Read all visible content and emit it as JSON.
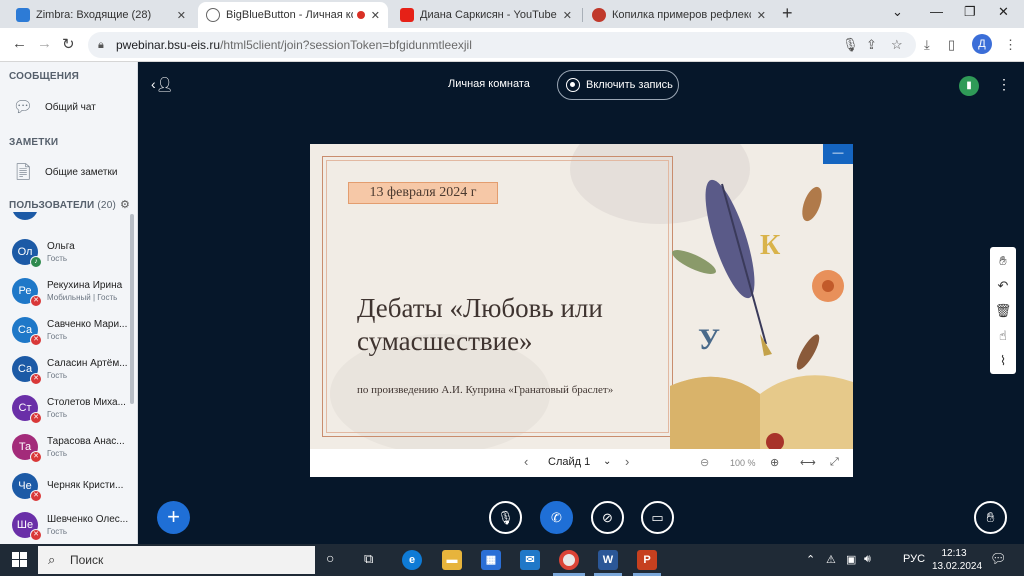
{
  "browser": {
    "tabs": [
      {
        "title": "Zimbra: Входящие (28)",
        "icon": "zimbra-icon",
        "color": "#2d7bd6"
      },
      {
        "title": "BigBlueButton - Личная ком",
        "icon": "globe-icon",
        "color": "#555555",
        "active": true
      },
      {
        "title": "Диана Саркисян - YouTube",
        "icon": "youtube-icon",
        "color": "#e62117"
      },
      {
        "title": "Копилка примеров рефлекси",
        "icon": "star-icon",
        "color": "#c0392b"
      }
    ],
    "url_host": "pwebinar.bsu-eis.ru",
    "url_path": "/html5client/join?sessionToken=bfgidunmtleexjil",
    "profile_initial": "Д"
  },
  "sidebar": {
    "messages_title": "СООБЩЕНИЯ",
    "public_chat": "Общий чат",
    "notes_title": "ЗАМЕТКИ",
    "shared_notes": "Общие заметки",
    "users_title": "ПОЛЬЗОВАТЕЛИ",
    "users_count": "(20)",
    "users": [
      {
        "initials": "Ол",
        "name": "Ольга",
        "role": "Гость",
        "color": "#1c5aa6",
        "status": "ok"
      },
      {
        "initials": "Ре",
        "name": "Рекухина Ирина",
        "role": "Мобильный | Гость",
        "color": "#1f78c8",
        "status": "muted"
      },
      {
        "initials": "Са",
        "name": "Савченко Мари...",
        "role": "Гость",
        "color": "#1f78c8",
        "status": "muted"
      },
      {
        "initials": "Са",
        "name": "Саласин Артём...",
        "role": "Гость",
        "color": "#1c5aa6",
        "status": "muted"
      },
      {
        "initials": "Ст",
        "name": "Столетов Миха...",
        "role": "Гость",
        "color": "#6a2fa8",
        "status": "muted"
      },
      {
        "initials": "Та",
        "name": "Тарасова Анас...",
        "role": "Гость",
        "color": "#a32b7a",
        "status": "muted"
      },
      {
        "initials": "Че",
        "name": "Черняк Кристи...",
        "role": "",
        "color": "#1c5aa6",
        "status": "muted"
      },
      {
        "initials": "Ше",
        "name": "Шевченко Олес...",
        "role": "Гость",
        "color": "#6a2fa8",
        "status": "muted"
      }
    ]
  },
  "header": {
    "room_name": "Личная комната",
    "record_label": "Включить запись"
  },
  "slide": {
    "date": "13 февраля 2024 г",
    "title": "Дебаты «Любовь или сумасшествие»",
    "subtitle": "по произведению А.И. Куприна «Гранатовый браслет»",
    "slide_label": "Слайд 1",
    "zoom": "100 %"
  },
  "taskbar": {
    "search_placeholder": "Поиск",
    "lang": "РУС",
    "time": "12:13",
    "date": "13.02.2024"
  }
}
